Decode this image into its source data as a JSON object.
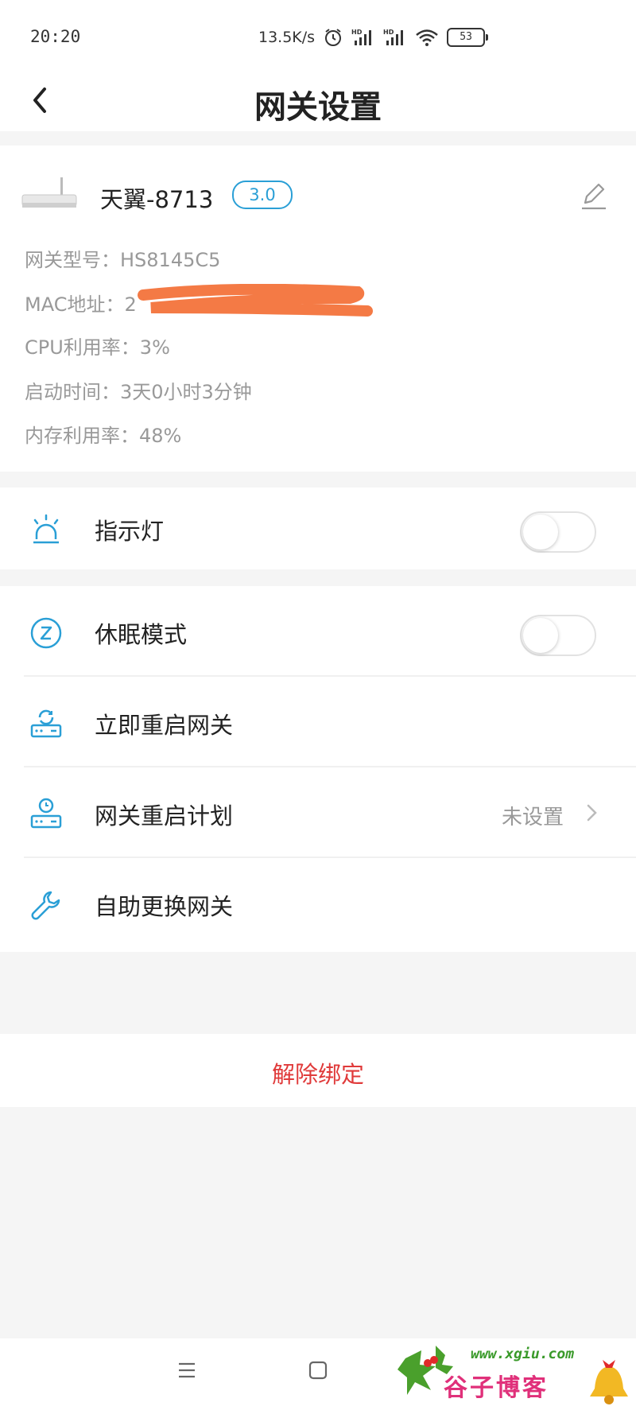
{
  "status_bar": {
    "time": "20:20",
    "network_speed": "13.5K/s",
    "battery": "53",
    "icons": [
      "alarm-icon",
      "hd-signal-icon",
      "hd-signal-icon",
      "wifi-icon",
      "battery-icon"
    ]
  },
  "header": {
    "title": "网关设置",
    "back_icon": "chevron-left-icon"
  },
  "device": {
    "name": "天翼-8713",
    "version_badge": "3.0",
    "info": [
      "网关型号：HS8145C5",
      "MAC地址：2",
      "CPU利用率：3%",
      "启动时间：3天0小时3分钟",
      "内存利用率：48%"
    ],
    "edit_icon": "pencil-icon",
    "mac_redacted_color": "#f47a45"
  },
  "settings": {
    "indicator_light": {
      "label": "指示灯",
      "enabled": false
    },
    "sleep_mode": {
      "label": "休眠模式",
      "enabled": false
    },
    "restart_now": {
      "label": "立即重启网关"
    },
    "restart_plan": {
      "label": "网关重启计划",
      "value": "未设置"
    },
    "replace_gateway": {
      "label": "自助更换网关"
    }
  },
  "unbind": {
    "label": "解除绑定",
    "color": "#e03a3a"
  },
  "colors": {
    "accent": "#2a9fd6",
    "background": "#f5f5f5"
  },
  "watermark": {
    "url": "www.xgiu.com",
    "brand": "谷子博客"
  }
}
